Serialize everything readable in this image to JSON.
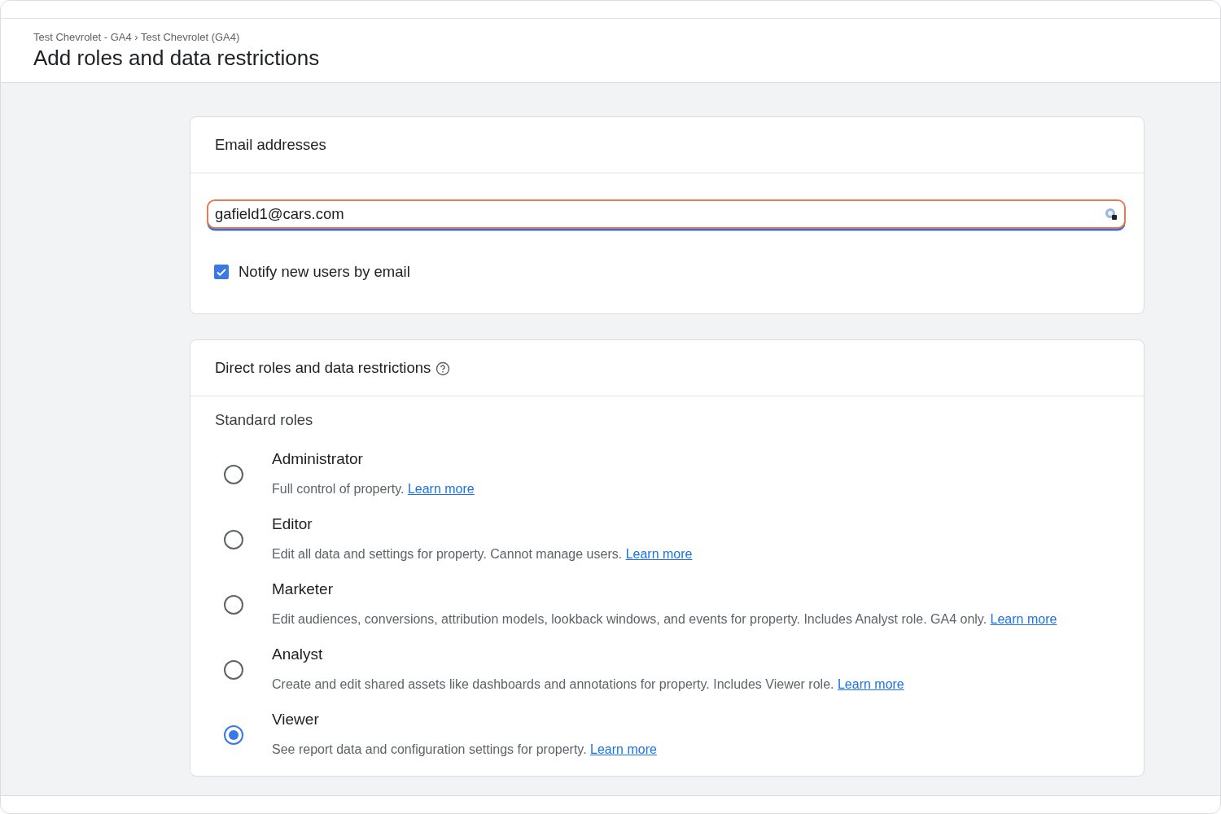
{
  "header": {
    "breadcrumb": "Test Chevrolet - GA4 › Test Chevrolet (GA4)",
    "title": "Add roles and data restrictions"
  },
  "email_card": {
    "title": "Email addresses",
    "email_field": {
      "value": "gafield1@cars.com",
      "focused": true
    },
    "notify": {
      "label": "Notify new users by email",
      "checked": true
    }
  },
  "roles_card": {
    "title": "Direct roles and data restrictions",
    "section": "Standard roles",
    "roles": [
      {
        "name": "Administrator",
        "description": "Full control of property.",
        "link": "Learn more",
        "selected": false
      },
      {
        "name": "Editor",
        "description": "Edit all data and settings for property. Cannot manage users.",
        "link": "Learn more",
        "selected": false
      },
      {
        "name": "Marketer",
        "description": "Edit audiences, conversions, attribution models, lookback windows, and events for property. Includes Analyst role. GA4 only.",
        "link": "Learn more",
        "selected": false
      },
      {
        "name": "Analyst",
        "description": "Create and edit shared assets like dashboards and annotations for property. Includes Viewer role.",
        "link": "Learn more",
        "selected": false
      },
      {
        "name": "Viewer",
        "description": "See report data and configuration settings for property.",
        "link": "Learn more",
        "selected": true
      }
    ]
  }
}
